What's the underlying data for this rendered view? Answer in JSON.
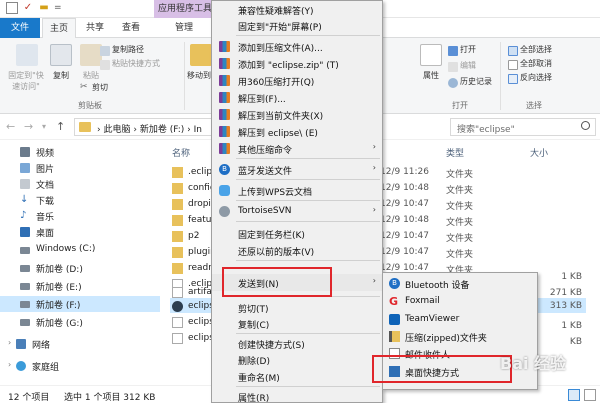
{
  "ribbon": {
    "context_tab": "应用程序工具",
    "tabs": [
      "文件",
      "主页",
      "共享",
      "查看",
      "管理"
    ],
    "pin_label_1": "固定到\"快",
    "pin_label_2": "速访问\"",
    "copy": "复制",
    "paste": "粘贴",
    "copy_path": "复制路径",
    "paste_shortcut": "粘贴快捷方式",
    "cut": "剪切",
    "clipboard_group": "剪贴板",
    "move_to": "移动到",
    "open": "打开",
    "edit": "编辑",
    "history": "历史记录",
    "properties": "属性",
    "open_group": "打开",
    "select_all": "全部选择",
    "select_none": "全部取消",
    "invert_selection": "反向选择",
    "select_group": "选择"
  },
  "address": {
    "path": [
      "此电脑",
      "新加卷 (F:)",
      "In"
    ],
    "search_placeholder": "搜索\"eclipse\""
  },
  "nav": {
    "items": [
      "视频",
      "图片",
      "文档",
      "下载",
      "音乐",
      "桌面",
      "Windows (C:)",
      "新加卷 (D:)",
      "新加卷 (E:)",
      "新加卷 (F:)",
      "新加卷 (G:)",
      "网络",
      "家庭组"
    ]
  },
  "list": {
    "columns": {
      "name": "名称",
      "type": "类型",
      "size": "大小"
    },
    "files": [
      {
        "name": ".eclip",
        "date": "12/9 11:26",
        "type": "文件夹",
        "size": ""
      },
      {
        "name": "config",
        "date": "12/9 10:48",
        "type": "文件夹",
        "size": ""
      },
      {
        "name": "dropi",
        "date": "12/9 10:47",
        "type": "文件夹",
        "size": ""
      },
      {
        "name": "featur",
        "date": "12/9 10:48",
        "type": "文件夹",
        "size": ""
      },
      {
        "name": "p2",
        "date": "12/9 10:47",
        "type": "文件夹",
        "size": ""
      },
      {
        "name": "plugir",
        "date": "12/9 10:47",
        "type": "文件夹",
        "size": ""
      },
      {
        "name": "readn",
        "date": "12/9 10:47",
        "type": "文件夹",
        "size": ""
      },
      {
        "name": ".eclip",
        "date": "",
        "type": "",
        "size": "1 KB"
      },
      {
        "name": "artifa",
        "date": "",
        "type": "",
        "size": "271 KB"
      },
      {
        "name": "eclips",
        "date": "",
        "type": "",
        "size": "313 KB"
      },
      {
        "name": "eclips",
        "date": "",
        "type": "",
        "size": "1 KB"
      },
      {
        "name": "eclips",
        "date": "",
        "type": "",
        "size": "KB"
      }
    ]
  },
  "status": {
    "count": "12 个项目",
    "selection": "选中 1 个项目  312 KB"
  },
  "context_menu": {
    "items": [
      "兼容性疑难解答(Y)",
      "固定到\"开始\"屏幕(P)",
      "添加到压缩文件(A)...",
      "添加到 \"eclipse.zip\" (T)",
      "用360压缩打开(Q)",
      "解压到(F)...",
      "解压到当前文件夹(X)",
      "解压到 eclipse\\ (E)",
      "其他压缩命令",
      "蓝牙发送文件",
      "上传到WPS云文档",
      "TortoiseSVN",
      "固定到任务栏(K)",
      "还原以前的版本(V)",
      "发送到(N)",
      "剪切(T)",
      "复制(C)",
      "创建快捷方式(S)",
      "删除(D)",
      "重命名(M)",
      "属性(R)"
    ]
  },
  "send_to_menu": {
    "items": [
      "Bluetooth 设备",
      "Foxmail",
      "TeamViewer",
      "压缩(zipped)文件夹",
      "邮件收件人",
      "桌面快捷方式"
    ]
  },
  "watermark": "Bai 经验",
  "colors": {
    "accent": "#1979ca",
    "highlight_box": "#e0262b",
    "selection": "#cce8ff",
    "context_tab": "#d8bfe6"
  }
}
